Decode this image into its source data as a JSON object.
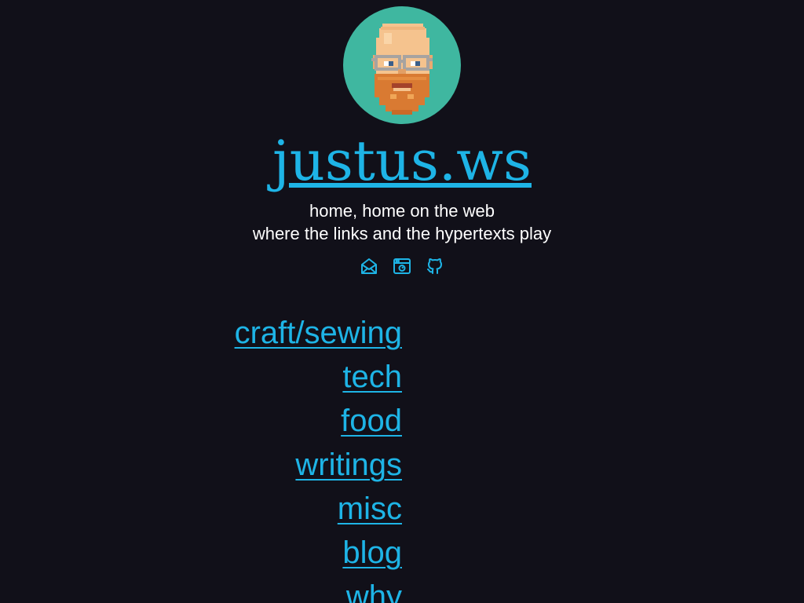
{
  "site": {
    "title": "justus.ws",
    "tagline_line1": "home, home on the web",
    "tagline_line2": "where the links and the hypertexts play"
  },
  "icons": [
    {
      "name": "mail-icon"
    },
    {
      "name": "browser-icon"
    },
    {
      "name": "github-icon"
    }
  ],
  "nav": {
    "items": [
      {
        "label": "craft/sewing"
      },
      {
        "label": "tech"
      },
      {
        "label": "food"
      },
      {
        "label": "writings"
      },
      {
        "label": "misc"
      },
      {
        "label": "blog"
      },
      {
        "label": "why"
      }
    ]
  },
  "colors": {
    "background": "#111019",
    "link": "#1eb4e6",
    "text": "#ffffff",
    "avatar_bg": "#3fb7a0"
  }
}
